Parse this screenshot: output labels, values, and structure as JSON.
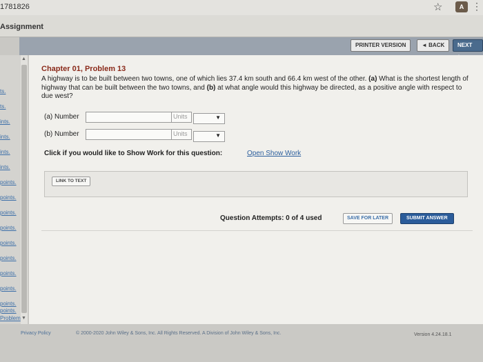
{
  "browser": {
    "url_fragment": "1781826"
  },
  "assignment": {
    "title": "Assignment"
  },
  "toolbar": {
    "printer_label": "PRINTER VERSION",
    "back_label": "◄ BACK",
    "next_label": "NEXT ►"
  },
  "sidebar": {
    "items": [
      "ts.",
      "ts.",
      "ints.",
      "ints.",
      "ints.",
      "ints.",
      "points.",
      "points.",
      "points.",
      "points.",
      "points.",
      "points.",
      "points.",
      "points.",
      "points.",
      "points.",
      "Problem"
    ]
  },
  "problem": {
    "title": "Chapter 01, Problem 13",
    "text_1": "A highway is to be built between two towns, one of which lies 37.4 km south and 66.4 km west of the other. ",
    "part_a_marker": "(a)",
    "text_2": " What is the shortest length of highway that can be built between the two towns, and ",
    "part_b_marker": "(b)",
    "text_3": " at what angle would this highway be directed, as a positive angle with respect to due west?"
  },
  "fields": {
    "a_label": "(a) Number",
    "a_value": "",
    "a_units_label": "Units",
    "b_label": "(b) Number",
    "b_value": "",
    "b_units_label": "Units"
  },
  "showwork": {
    "prompt": "Click if you would like to Show Work for this question:",
    "link": "Open Show Work"
  },
  "link_to_text": "LINK TO TEXT",
  "attempts": "Question Attempts: 0 of 4 used",
  "actions": {
    "save_label": "SAVE FOR LATER",
    "submit_label": "SUBMIT ANSWER"
  },
  "footer": {
    "privacy": "Privacy Policy",
    "copyright": "© 2000-2020 John Wiley & Sons, Inc. All Rights Reserved. A Division of John Wiley & Sons, Inc.",
    "version": "Version 4.24.18.1"
  },
  "colors": {
    "accent": "#2b5c9a",
    "title_red": "#8a2a1a",
    "link_blue": "#2a5d9c"
  }
}
